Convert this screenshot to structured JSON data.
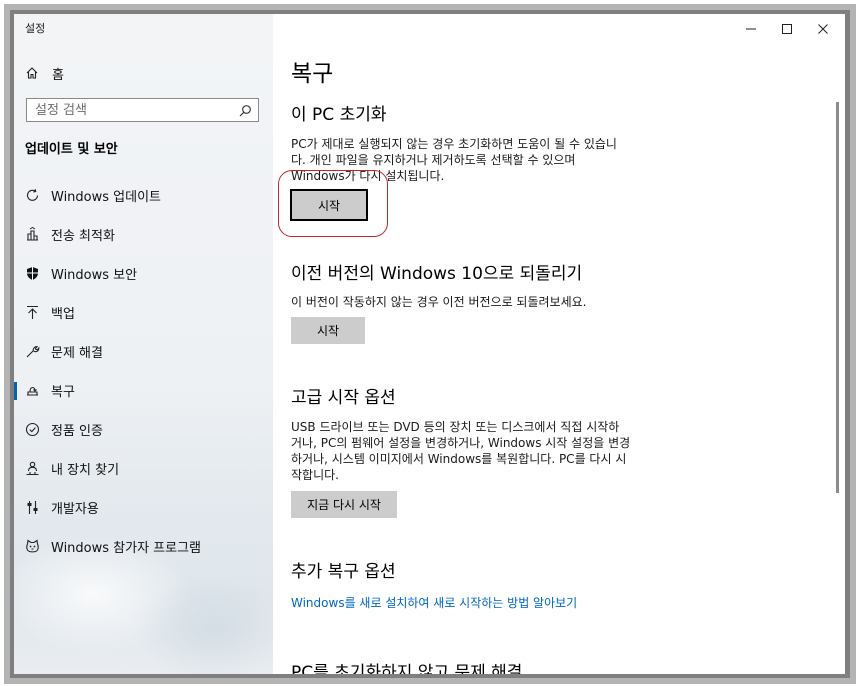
{
  "window": {
    "title": "설정"
  },
  "sidebar": {
    "home_label": "홈",
    "search_placeholder": "설정 검색",
    "section_title": "업데이트 및 보안",
    "items": [
      {
        "label": "Windows 업데이트",
        "icon": "refresh-icon"
      },
      {
        "label": "전송 최적화",
        "icon": "delivery-optimization-icon"
      },
      {
        "label": "Windows 보안",
        "icon": "shield-icon"
      },
      {
        "label": "백업",
        "icon": "backup-arrow-icon"
      },
      {
        "label": "문제 해결",
        "icon": "wrench-icon"
      },
      {
        "label": "복구",
        "icon": "recovery-icon"
      },
      {
        "label": "정품 인증",
        "icon": "check-circle-icon"
      },
      {
        "label": "내 장치 찾기",
        "icon": "person-location-icon"
      },
      {
        "label": "개발자용",
        "icon": "developer-sliders-icon"
      },
      {
        "label": "Windows 참가자 프로그램",
        "icon": "insider-cat-icon"
      }
    ],
    "active_item": "복구"
  },
  "main": {
    "page_title": "복구",
    "sections": {
      "reset": {
        "title": "이 PC 초기화",
        "lines": [
          "PC가 제대로 실행되지 않는 경우 초기화하면 도움이 될 수 있습니",
          "다. 개인 파일을 유지하거나 제거하도록 선택할 수 있으며",
          "Windows가 다시 설치됩니다."
        ],
        "button": "시작"
      },
      "go_back": {
        "title": "이전 버전의 Windows 10으로 되돌리기",
        "description": "이 버전이 작동하지 않는 경우 이전 버전으로 되돌려보세요.",
        "button": "시작"
      },
      "advanced": {
        "title": "고급 시작 옵션",
        "lines": [
          "USB 드라이브 또는 DVD 등의 장치 또는 디스크에서 직접 시작하",
          "거나, PC의 펌웨어 설정을 변경하거나, Windows 시작 설정을 변경",
          "하거나, 시스템 이미지에서 Windows를 복원합니다. PC를 다시 시",
          "작합니다."
        ],
        "button": "지금 다시 시작"
      },
      "more": {
        "title": "추가 복구 옵션",
        "link": "Windows를 새로 설치하여 새로 시작하는 방법 알아보기"
      },
      "fix_without_reset": {
        "title": "PC를 초기화하지 않고 문제 해결"
      }
    }
  },
  "colors": {
    "accent": "#0063b1",
    "link": "#0067c0",
    "button": "#cccccc",
    "annotation": "#c6242b"
  }
}
